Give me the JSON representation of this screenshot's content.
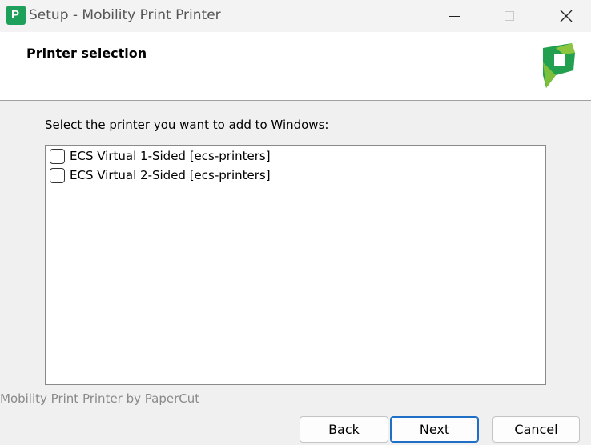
{
  "window": {
    "title": "Setup - Mobility Print Printer",
    "icon": "papercut-app-icon",
    "controls": [
      "minimize",
      "maximize",
      "close"
    ]
  },
  "header": {
    "title": "Printer selection",
    "logo": "papercut-logo"
  },
  "main": {
    "instruction": "Select the printer you want to add to Windows:",
    "printers": [
      {
        "label": "ECS Virtual 1-Sided [ecs-printers]",
        "checked": false
      },
      {
        "label": "ECS Virtual 2-Sided [ecs-printers]",
        "checked": false
      }
    ]
  },
  "footer": {
    "branding": "Mobility Print Printer by PaperCut",
    "back_label": "Back",
    "next_label": "Next",
    "cancel_label": "Cancel"
  },
  "colors": {
    "brand_green": "#1fa05a",
    "accent_blue": "#1f6fc7"
  }
}
